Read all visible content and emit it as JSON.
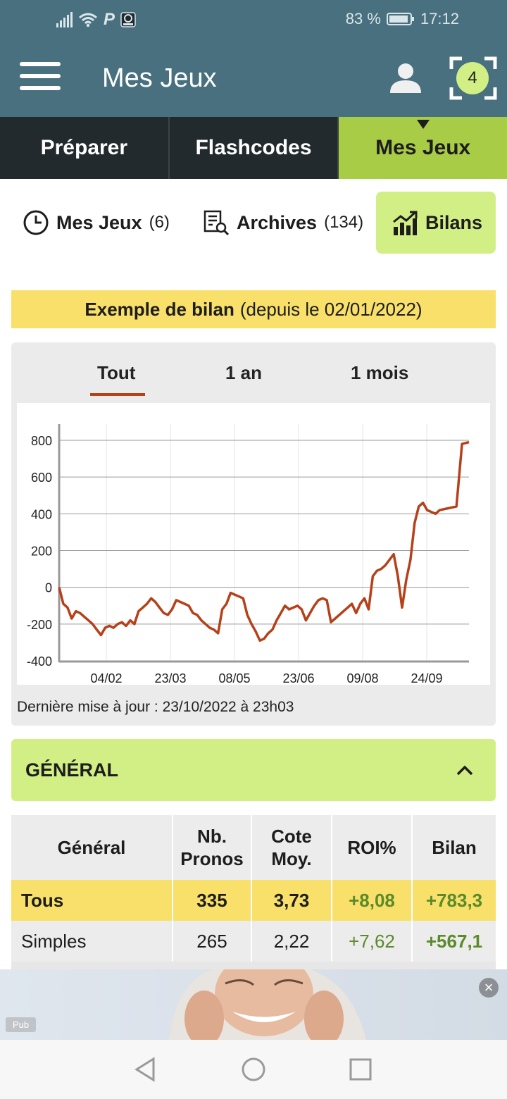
{
  "status_bar": {
    "carrier_glyph": "P",
    "battery": "83 %",
    "time": "17:12"
  },
  "app_bar": {
    "title": "Mes Jeux",
    "scan_count": "4",
    "icons": [
      "menu-icon",
      "user-icon",
      "scan-icon"
    ]
  },
  "main_tabs": [
    {
      "label": "Préparer",
      "active": false
    },
    {
      "label": "Flashcodes",
      "active": false
    },
    {
      "label": "Mes Jeux",
      "active": true
    }
  ],
  "sub_tabs": [
    {
      "label": "Mes Jeux",
      "count": "(6)",
      "icon": "clock-icon"
    },
    {
      "label": "Archives",
      "count": "(134)",
      "icon": "archive-search-icon"
    },
    {
      "label": "Bilans",
      "count": "",
      "icon": "chart-growth-icon",
      "active": true
    }
  ],
  "banner": {
    "bold": "Exemple de bilan",
    "rest": "(depuis le 02/01/2022)"
  },
  "period_tabs": [
    {
      "label": "Tout",
      "active": true
    },
    {
      "label": "1 an",
      "active": false
    },
    {
      "label": "1 mois",
      "active": false
    }
  ],
  "chart_data": {
    "type": "line",
    "title": "",
    "xlabel": "",
    "ylabel": "",
    "ylim": [
      -400,
      800
    ],
    "yticks": [
      800,
      600,
      400,
      200,
      0,
      -200,
      -400
    ],
    "xticks": [
      "04/02",
      "23/03",
      "08/05",
      "23/06",
      "09/08",
      "24/09"
    ],
    "grid": "horizontal",
    "color": "#b5411b",
    "series": [
      {
        "x": [
          "2022-01-02",
          "2022-01-05",
          "2022-01-08",
          "2022-01-11",
          "2022-01-14",
          "2022-01-17",
          "2022-01-20",
          "2022-01-23",
          "2022-01-26",
          "2022-01-29",
          "2022-02-01",
          "2022-02-04",
          "2022-02-07",
          "2022-02-10",
          "2022-02-13",
          "2022-02-16",
          "2022-02-19",
          "2022-02-22",
          "2022-02-25",
          "2022-02-28",
          "2022-03-03",
          "2022-03-06",
          "2022-03-09",
          "2022-03-12",
          "2022-03-15",
          "2022-03-18",
          "2022-03-21",
          "2022-03-24",
          "2022-03-27",
          "2022-03-30",
          "2022-04-02",
          "2022-04-05",
          "2022-04-08",
          "2022-04-11",
          "2022-04-14",
          "2022-04-17",
          "2022-04-20",
          "2022-04-23",
          "2022-04-26",
          "2022-04-29",
          "2022-05-02",
          "2022-05-05",
          "2022-05-08",
          "2022-05-11",
          "2022-05-14",
          "2022-05-17",
          "2022-05-20",
          "2022-05-23",
          "2022-05-26",
          "2022-05-29",
          "2022-06-01",
          "2022-06-04",
          "2022-06-07",
          "2022-06-10",
          "2022-06-13",
          "2022-06-16",
          "2022-06-19",
          "2022-06-22",
          "2022-06-25",
          "2022-06-28",
          "2022-07-01",
          "2022-07-04",
          "2022-07-07",
          "2022-07-10",
          "2022-07-13",
          "2022-07-16",
          "2022-07-19",
          "2022-07-22",
          "2022-07-25",
          "2022-07-28",
          "2022-07-31",
          "2022-08-03",
          "2022-08-06",
          "2022-08-09",
          "2022-08-12",
          "2022-08-15",
          "2022-08-18",
          "2022-08-21",
          "2022-08-24",
          "2022-08-27",
          "2022-08-30",
          "2022-09-02",
          "2022-09-05",
          "2022-09-08",
          "2022-09-11",
          "2022-09-14",
          "2022-09-17",
          "2022-09-20",
          "2022-09-23",
          "2022-09-26",
          "2022-09-29",
          "2022-10-02",
          "2022-10-08",
          "2022-10-14",
          "2022-10-18",
          "2022-10-23"
        ],
        "y": [
          0,
          -90,
          -110,
          -170,
          -130,
          -140,
          -160,
          -180,
          -200,
          -230,
          -260,
          -220,
          -210,
          -220,
          -200,
          -190,
          -210,
          -180,
          -200,
          -130,
          -110,
          -90,
          -60,
          -80,
          -110,
          -140,
          -150,
          -120,
          -70,
          -80,
          -90,
          -100,
          -140,
          -150,
          -180,
          -200,
          -220,
          -230,
          -250,
          -120,
          -90,
          -30,
          -40,
          -50,
          -60,
          -150,
          -200,
          -240,
          -290,
          -280,
          -250,
          -230,
          -180,
          -140,
          -100,
          -120,
          -110,
          -100,
          -120,
          -180,
          -140,
          -100,
          -70,
          -60,
          -70,
          -190,
          -170,
          -150,
          -130,
          -110,
          -90,
          -140,
          -90,
          -60,
          -120,
          60,
          90,
          100,
          120,
          150,
          180,
          60,
          -110,
          40,
          150,
          350,
          440,
          460,
          420,
          410,
          400,
          420,
          430,
          440,
          780,
          790
        ]
      }
    ]
  },
  "last_update": "Dernière mise à jour : 23/10/2022 à 23h03",
  "section": {
    "title": "GÉNÉRAL"
  },
  "table": {
    "headers": [
      "Général",
      "Nb.\nPronos",
      "Cote\nMoy.",
      "ROI%",
      "Bilan"
    ],
    "rows": [
      [
        "Tous",
        "335",
        "3,73",
        "+8,08",
        "+783,3"
      ],
      [
        "Simples",
        "265",
        "2,22",
        "+7,62",
        "+567,1"
      ]
    ]
  },
  "ad": {
    "label": "Pub"
  },
  "colors": {
    "app_bar": "#48707f",
    "tab_dark": "#222a2e",
    "accent_green": "#a9cc47",
    "light_green": "#d2ef86",
    "yellow": "#f8e06a",
    "chart_line": "#b5411b"
  }
}
